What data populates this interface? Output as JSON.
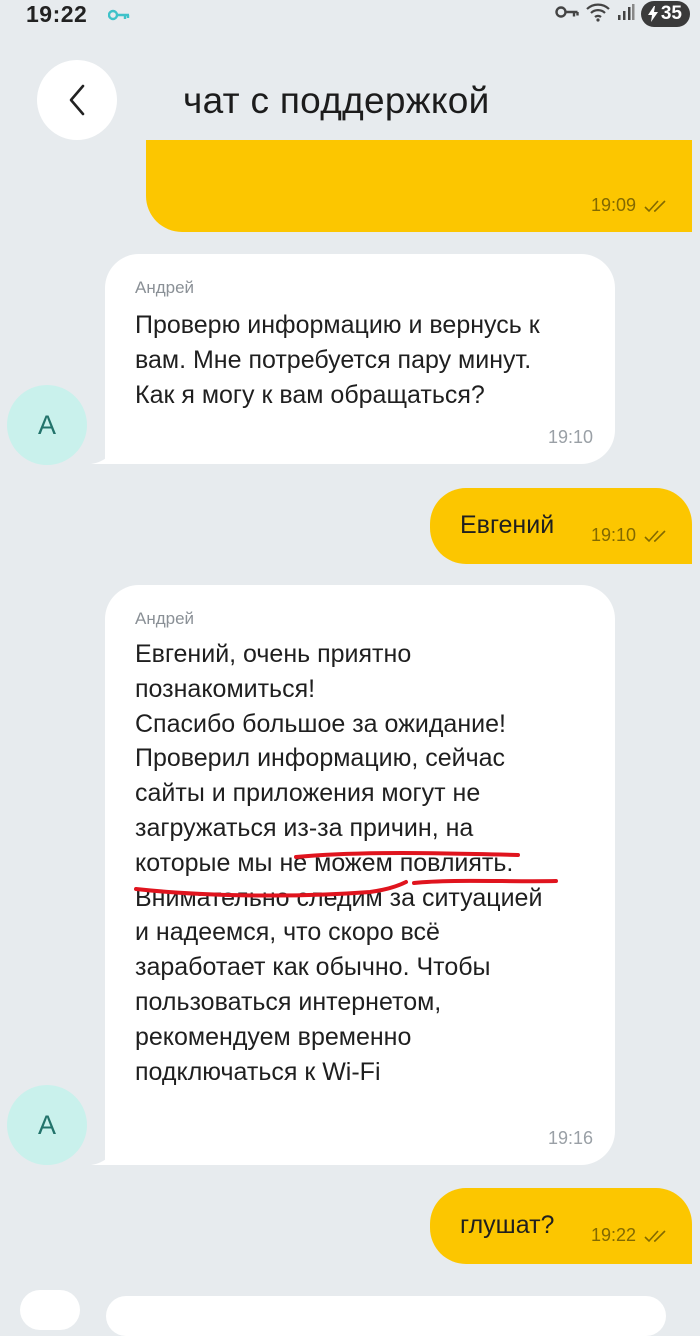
{
  "status_bar": {
    "time": "19:22",
    "battery": "35"
  },
  "header": {
    "title": "чат с поддержкой"
  },
  "messages": [
    {
      "time": "19:09"
    },
    {
      "sender": "Андрей",
      "text": "Проверю информацию и вернусь к\nвам. Мне потребуется пару минут.\nКак я могу к вам обращаться?",
      "time": "19:10",
      "avatar": "А"
    },
    {
      "text": "Евгений",
      "time": "19:10"
    },
    {
      "sender": "Андрей",
      "text": "Евгений, очень приятно\nпознакомиться!\nСпасибо большое за ожидание!\nПроверил информацию, сейчас\nсайты и приложения могут не\nзагружаться из-за причин, на\nкоторые мы не можем повлиять.\nВнимательно следим за ситуацией\nи надеемся, что скоро всё\nзаработает как обычно. Чтобы\nпользоваться интернетом,\nрекомендуем временно\nподключаться к Wi-Fi",
      "time": "19:16",
      "avatar": "А"
    },
    {
      "text": "глушат?",
      "time": "19:22"
    }
  ],
  "colors": {
    "outgoing": "#fcc600",
    "incoming": "#ffffff",
    "background": "#e7ebee",
    "avatar": "#c9f1ec",
    "annotation": "#e0141e"
  }
}
